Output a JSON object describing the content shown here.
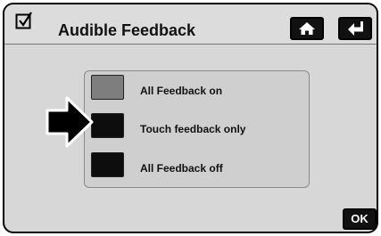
{
  "header": {
    "title": "Audible Feedback",
    "check_icon": "checkbox-checked-icon",
    "home_icon": "home-icon",
    "back_icon": "return-arrow-icon"
  },
  "options": [
    {
      "label": "All Feedback on",
      "state": "on"
    },
    {
      "label": "Touch feedback only",
      "state": "off"
    },
    {
      "label": "All Feedback off",
      "state": "off"
    }
  ],
  "selection_pointer": {
    "icon": "right-arrow-pointer-icon",
    "target_option": "Touch feedback only"
  },
  "ok_button": {
    "label": "OK"
  },
  "colors": {
    "screen_bg": "#d7d7d7",
    "swatch_on": "#7e7e7e",
    "swatch_off": "#0d0d0d",
    "button_bg": "#111111"
  }
}
